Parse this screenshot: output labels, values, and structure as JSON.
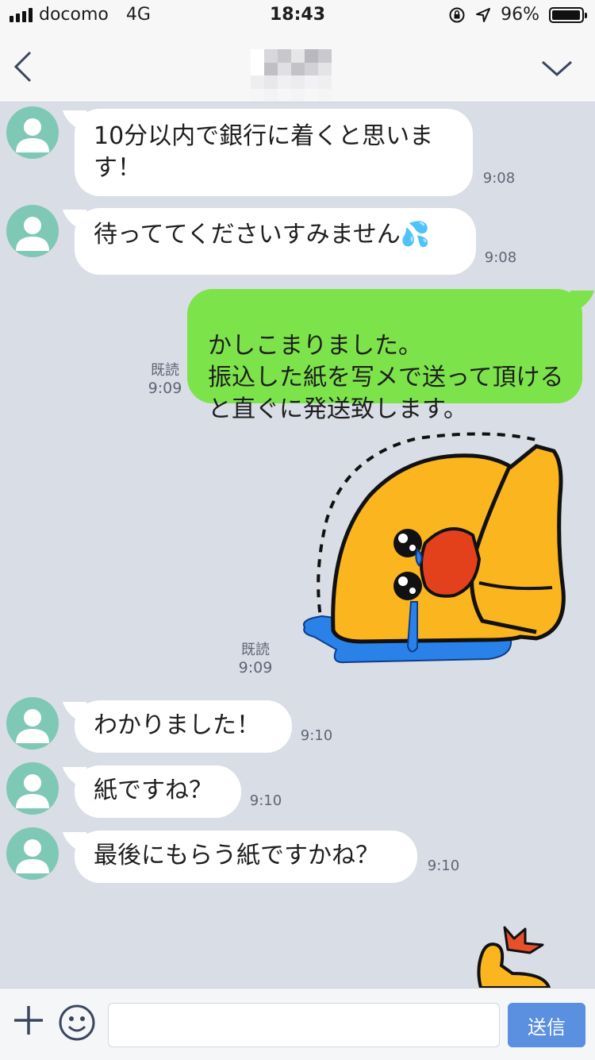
{
  "status_bar": {
    "carrier": "docomo",
    "network": "4G",
    "time": "18:43",
    "battery": "96%",
    "battery_level": 0.96
  },
  "header": {
    "back_icon": "chevron-left-icon",
    "dropdown_icon": "chevron-down-icon",
    "title_pixelated": true
  },
  "messages": [
    {
      "direction": "in",
      "text": "10分以内で銀行に着くと思います！",
      "time": "9:08"
    },
    {
      "direction": "in",
      "text": "待っててくださいすみません💦",
      "time": "9:08"
    },
    {
      "direction": "out",
      "text": "かしこまりました。\n振込した紙を写メで送って頂けると直ぐに発送致します。",
      "read": "既読",
      "time": "9:09"
    },
    {
      "direction": "out",
      "type": "sticker",
      "sticker": "crying-chick-sticker",
      "read": "既読",
      "time": "9:09"
    },
    {
      "direction": "in",
      "text": "わかりました！",
      "time": "9:10"
    },
    {
      "direction": "in",
      "text": "紙ですね？",
      "time": "9:10"
    },
    {
      "direction": "in",
      "text": "最後にもらう紙ですかね？",
      "time": "9:10"
    }
  ],
  "input": {
    "plus_icon": "plus-icon",
    "emoji_icon": "smiley-icon",
    "placeholder": "",
    "send_label": "送信"
  },
  "colors": {
    "chat_background": "#d9dde6",
    "outgoing_bubble": "#7de34a",
    "incoming_bubble": "#ffffff",
    "avatar": "#7fc8b5",
    "send_button": "#5b8fe0"
  }
}
